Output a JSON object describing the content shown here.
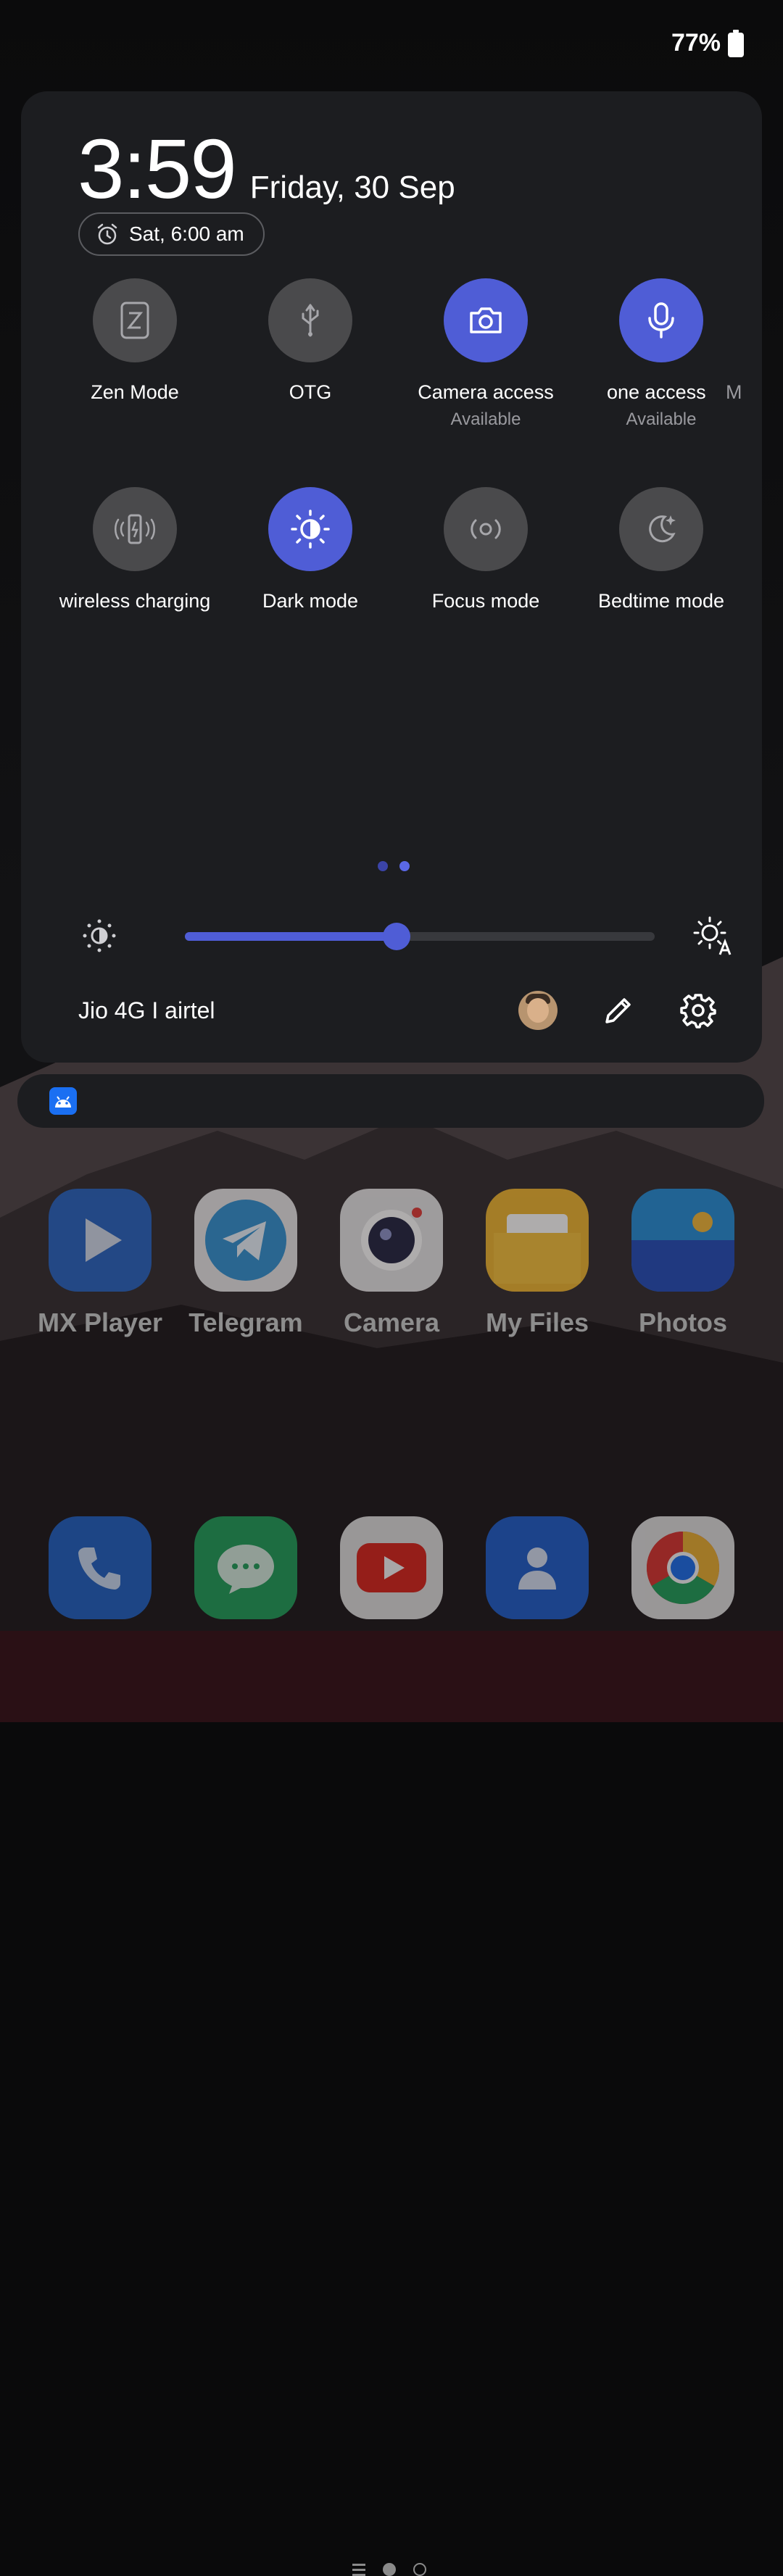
{
  "status_bar": {
    "battery_text": "77%"
  },
  "quick_settings": {
    "time": "3:59",
    "date": "Friday, 30 Sep",
    "alarm": "Sat, 6:00 am",
    "tiles_row1": [
      {
        "label": "Zen Mode",
        "sub": "",
        "state": "off",
        "icon": "zen-mode-icon"
      },
      {
        "label": "OTG",
        "sub": "",
        "state": "off",
        "icon": "usb-icon"
      },
      {
        "label": "Camera access",
        "sub": "Available",
        "state": "on",
        "icon": "camera-icon"
      },
      {
        "label": "one access",
        "sub": "Available",
        "state": "on",
        "icon": "microphone-icon"
      }
    ],
    "edge_tile_label": "M",
    "tiles_row2": [
      {
        "label": "wireless charging",
        "state": "off",
        "icon": "reverse-wireless-charging-icon"
      },
      {
        "label": "Dark mode",
        "state": "on",
        "icon": "dark-mode-icon"
      },
      {
        "label": "Focus mode",
        "state": "off",
        "icon": "focus-mode-icon"
      },
      {
        "label": "Bedtime mode",
        "state": "off",
        "icon": "bedtime-moon-icon"
      }
    ],
    "page_indicator": {
      "pages": 2,
      "current": 2
    },
    "brightness_level": 0.45,
    "network": "Jio 4G I airtel"
  },
  "home_apps": [
    {
      "name": "MX Player",
      "icon": "mx-player-icon"
    },
    {
      "name": "Telegram",
      "icon": "telegram-icon"
    },
    {
      "name": "Camera",
      "icon": "camera-app-icon"
    },
    {
      "name": "My Files",
      "icon": "my-files-icon"
    },
    {
      "name": "Photos",
      "icon": "photos-icon"
    }
  ],
  "dock_apps": [
    {
      "icon": "phone-app-icon"
    },
    {
      "icon": "messages-app-icon"
    },
    {
      "icon": "youtube-app-icon"
    },
    {
      "icon": "contacts-app-icon"
    },
    {
      "icon": "chrome-app-icon"
    }
  ],
  "colors": {
    "accent": "#4f5dd6",
    "panel": "#1c1d20",
    "tile_off": "#4a4a4c"
  }
}
